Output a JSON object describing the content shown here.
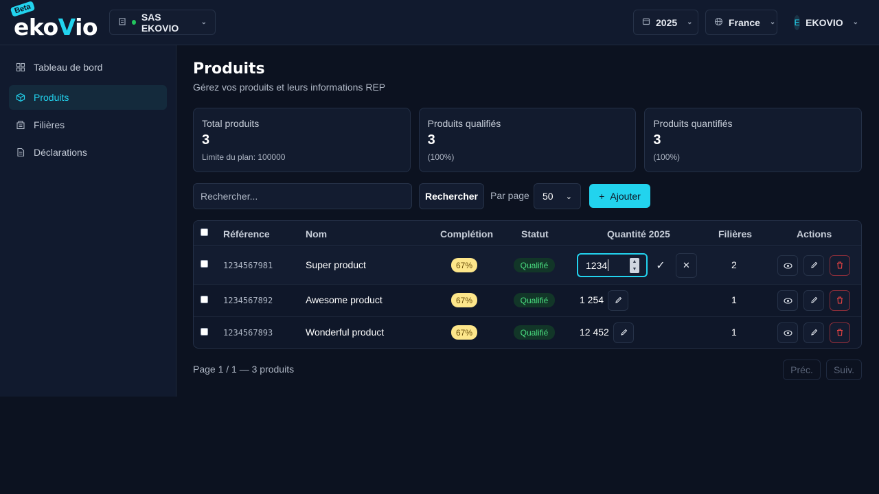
{
  "header": {
    "logo_badge": "Beta",
    "logo_text_left": "eko",
    "logo_text_v": "V",
    "logo_text_right": "io",
    "org": "SAS EKOVIO",
    "year": "2025",
    "country": "France",
    "user_initial": "E",
    "user_name": "EKOVIO"
  },
  "sidebar": {
    "items": [
      {
        "label": "Tableau de bord",
        "icon": "dashboard-icon"
      },
      {
        "label": "Produits",
        "icon": "cube-icon",
        "active": true
      },
      {
        "label": "Filières",
        "icon": "building-icon"
      },
      {
        "label": "Déclarations",
        "icon": "file-icon"
      }
    ]
  },
  "page": {
    "title": "Produits",
    "subtitle": "Gérez vos produits et leurs informations REP"
  },
  "cards": [
    {
      "label": "Total produits",
      "value": "3",
      "note": "Limite du plan: 100000"
    },
    {
      "label": "Produits qualifiés",
      "value": "3",
      "note": "(100%)"
    },
    {
      "label": "Produits quantifiés",
      "value": "3",
      "note": "(100%)"
    }
  ],
  "toolbar": {
    "search_placeholder": "Rechercher...",
    "search_button": "Rechercher",
    "per_page_label": "Par page",
    "per_page_value": "50",
    "add_button": "Ajouter"
  },
  "table": {
    "headers": {
      "reference": "Référence",
      "name": "Nom",
      "completion": "Complétion",
      "status": "Statut",
      "quantity": "Quantité 2025",
      "filieres": "Filières",
      "actions": "Actions"
    },
    "rows": [
      {
        "reference": "1234567981",
        "name": "Super product",
        "completion": "67%",
        "status": "Qualifié",
        "quantity": "1234",
        "filieres": "2",
        "editing": true
      },
      {
        "reference": "1234567892",
        "name": "Awesome product",
        "completion": "67%",
        "status": "Qualifié",
        "quantity": "1 254",
        "filieres": "1"
      },
      {
        "reference": "1234567893",
        "name": "Wonderful product",
        "completion": "67%",
        "status": "Qualifié",
        "quantity": "12 452",
        "filieres": "1"
      }
    ]
  },
  "pagination": {
    "summary": "Page 1 / 1 — 3 produits",
    "prev": "Préc.",
    "next": "Suiv."
  }
}
